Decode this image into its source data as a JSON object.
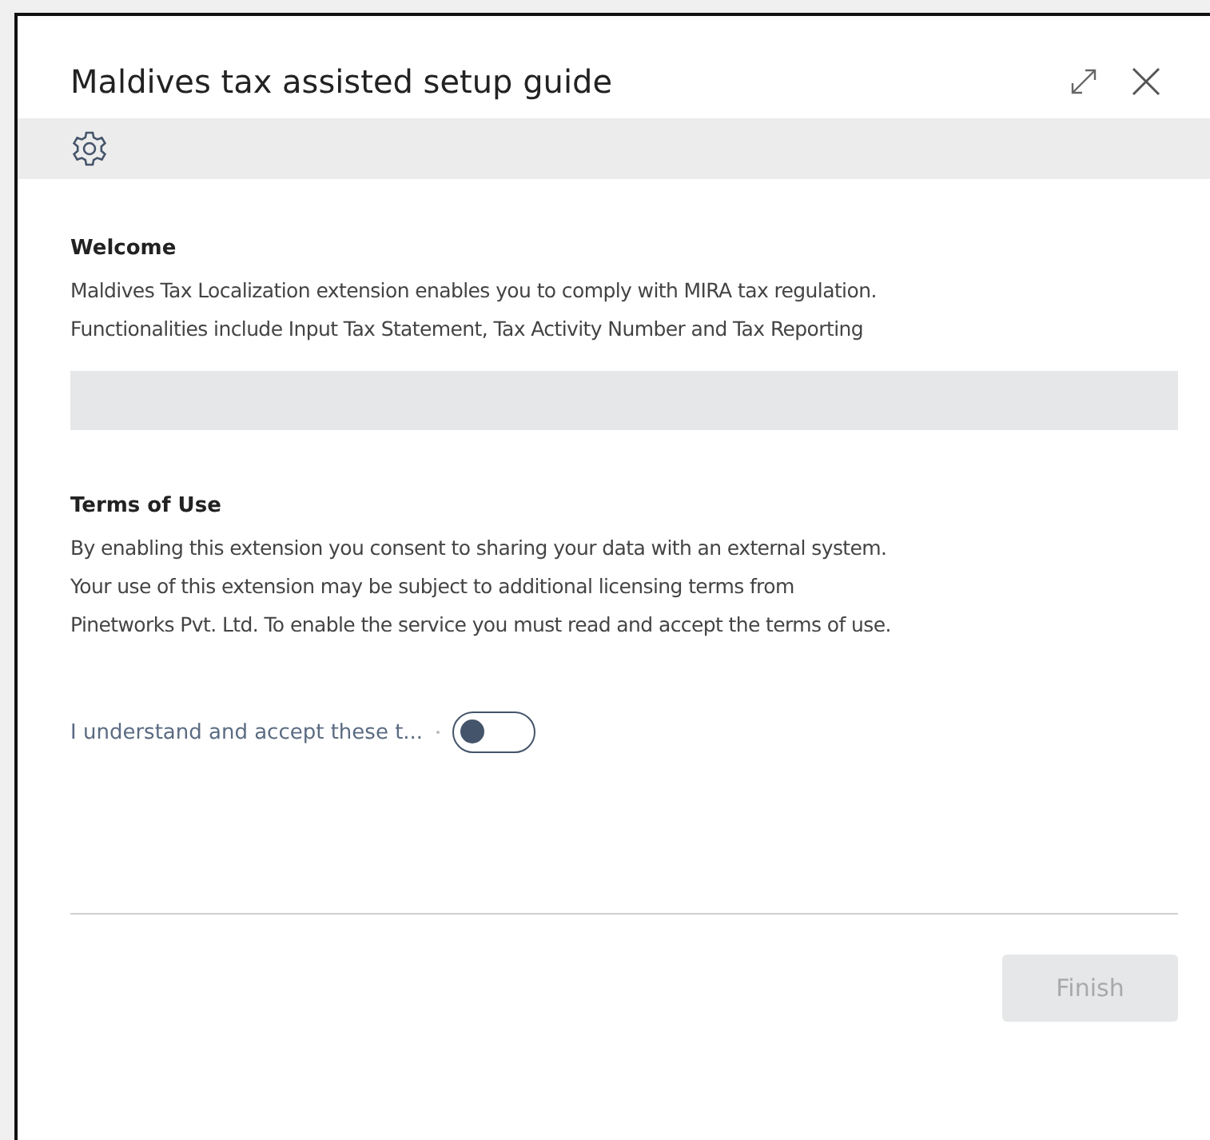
{
  "window": {
    "title": "Maldives tax assisted setup guide"
  },
  "welcome": {
    "heading": "Welcome",
    "lines": [
      "Maldives Tax Localization extension enables you to comply with MIRA tax regulation.",
      "Functionalities include Input Tax Statement, Tax Activity Number and Tax Reporting"
    ]
  },
  "terms": {
    "heading": "Terms of Use",
    "lines": [
      "By enabling this extension you consent to sharing your data with an external system.",
      "Your use of this extension may be subject to additional licensing terms from",
      "Pinetworks Pvt. Ltd. To enable the service you must read and accept the terms of use."
    ]
  },
  "accept": {
    "label": "I understand and accept these t...",
    "on": false
  },
  "buttons": [
    {
      "label": "Finish",
      "disabled": true
    }
  ]
}
